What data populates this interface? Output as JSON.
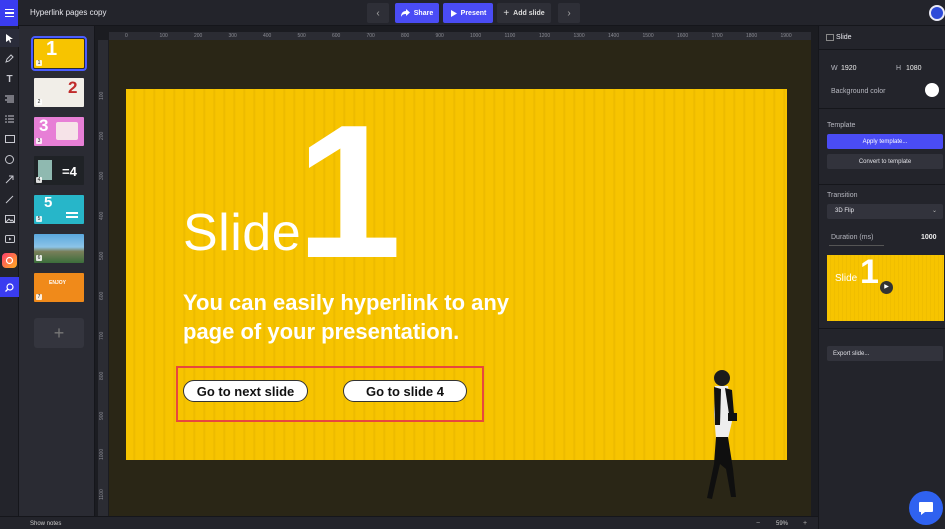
{
  "topbar": {
    "title": "Hyperlink pages copy",
    "prev_icon": "‹",
    "share_label": "Share",
    "present_label": "Present",
    "add_slide_label": "Add slide",
    "next_icon": "›"
  },
  "tools": [
    "pointer-icon",
    "pen-icon",
    "text-icon",
    "align-icon",
    "list-icon",
    "rectangle-icon",
    "circle-icon",
    "arrow-icon",
    "line-icon",
    "image-icon",
    "video-icon",
    "brand-icon",
    "search-icon"
  ],
  "thumbnails": [
    {
      "num": "1",
      "big": "1"
    },
    {
      "num": "2",
      "big": "2"
    },
    {
      "num": "3",
      "big": "3"
    },
    {
      "num": "4",
      "big": "=4"
    },
    {
      "num": "5",
      "big": "5"
    },
    {
      "num": "6",
      "big": ""
    },
    {
      "num": "7",
      "big": "ENJOY"
    }
  ],
  "add_slide_icon": "+",
  "ruler": {
    "h": [
      "0",
      "100",
      "200",
      "300",
      "400",
      "500",
      "600",
      "700",
      "800",
      "900",
      "1000",
      "1100",
      "1200",
      "1300",
      "1400",
      "1500",
      "1600",
      "1700",
      "1800",
      "1900"
    ],
    "v": [
      "100",
      "200",
      "300",
      "400",
      "500",
      "600",
      "700",
      "800",
      "900",
      "1000",
      "1100"
    ]
  },
  "slide": {
    "word": "Slide",
    "digit": "1",
    "subtitle": "You can easily hyperlink to any page of your presentation.",
    "btn_next": "Go to next slide",
    "btn_slide4": "Go to slide 4"
  },
  "status": {
    "show_notes": "Show notes",
    "zoom_minus": "−",
    "zoom": "59%",
    "zoom_plus": "+"
  },
  "panel": {
    "header": "Slide",
    "w_label": "W",
    "w_value": "1920",
    "h_label": "H",
    "h_value": "1080",
    "bg_label": "Background color",
    "template_label": "Template",
    "apply_template": "Apply template...",
    "convert_template": "Convert to template",
    "transition_label": "Transition",
    "transition_value": "3D Flip",
    "duration_label": "Duration (ms)",
    "duration_value": "1000",
    "preview_word": "Slide",
    "preview_digit": "1",
    "export_slide": "Export slide..."
  },
  "colors": {
    "accent": "#4a4cf5",
    "slide_yellow": "#f7c400",
    "highlight": "#e8473e"
  }
}
